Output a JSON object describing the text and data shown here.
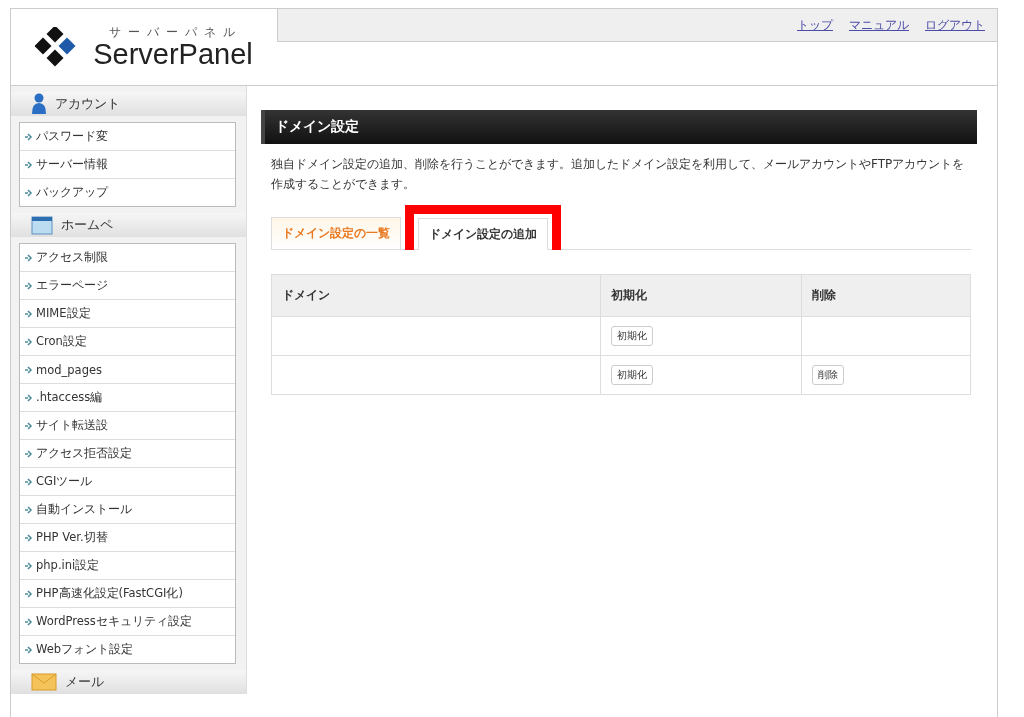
{
  "logo": {
    "kana": "サーバーパネル",
    "name": "ServerPanel"
  },
  "top_links": [
    "トップ",
    "マニュアル",
    "ログアウト"
  ],
  "sidebar": [
    {
      "title": "アカウント",
      "kind": "account",
      "items": [
        "パスワード変",
        "サーバー情報",
        "バックアップ"
      ]
    },
    {
      "title": "ホームペ",
      "kind": "home",
      "items": [
        "アクセス制限",
        "エラーページ",
        "MIME設定",
        "Cron設定",
        "mod_pages",
        ".htaccess編",
        "サイト転送設",
        "アクセス拒否設定",
        "CGIツール",
        "自動インストール",
        "PHP Ver.切替",
        "php.ini設定",
        "PHP高速化設定(FastCGI化)",
        "WordPressセキュリティ設定",
        "Webフォント設定"
      ]
    },
    {
      "title": "メール",
      "kind": "mail"
    }
  ],
  "page_title": "ドメイン設定",
  "description": "独自ドメイン設定の追加、削除を行うことができます。追加したドメイン設定を利用して、メールアカウントやFTPアカウントを作成することができます。",
  "tabs": [
    {
      "label": "ドメイン設定の一覧",
      "selected": true,
      "highlighted": false
    },
    {
      "label": "ドメイン設定の追加",
      "selected": false,
      "highlighted": true
    }
  ],
  "table": {
    "columns": [
      "ドメイン",
      "初期化",
      "削除"
    ],
    "rows": [
      {
        "reset": "初期化"
      },
      {
        "reset": "初期化",
        "delete": "削除"
      }
    ]
  }
}
